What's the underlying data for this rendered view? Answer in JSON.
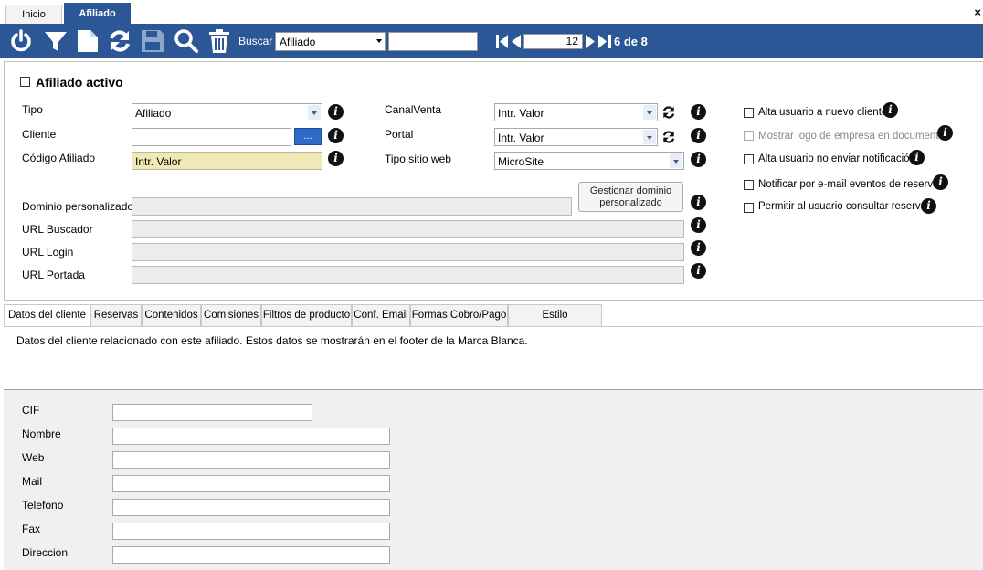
{
  "tabs": {
    "inicio": "Inicio",
    "afiliado": "Afiliado",
    "close": "×"
  },
  "toolbar": {
    "icons": [
      "power-icon",
      "filter-icon",
      "new-document-icon",
      "refresh-icon",
      "save-icon",
      "search-icon",
      "delete-icon"
    ],
    "buscar_label": "Buscar",
    "buscar_value": "Afiliado",
    "search_text": "",
    "page_value": "12",
    "count": "6 de 8"
  },
  "form": {
    "active_label": "Afiliado activo",
    "tipo_label": "Tipo",
    "tipo_value": "Afiliado",
    "cliente_label": "Cliente",
    "cliente_value": "",
    "ellipsis": "...",
    "codigo_label": "Código Afiliado",
    "codigo_value": "Intr. Valor",
    "canal_label": "CanalVenta",
    "canal_value": "Intr. Valor",
    "portal_label": "Portal",
    "portal_value": "Intr. Valor",
    "tipo_sitio_label": "Tipo sitio web",
    "tipo_sitio_value": "MicroSite",
    "gestionar_line1": "Gestionar dominio",
    "gestionar_line2": "personalizado",
    "dominio_label": "Dominio personalizado",
    "url_buscador_label": "URL Buscador",
    "url_login_label": "URL Login",
    "url_portada_label": "URL Portada"
  },
  "options": [
    {
      "label": "Alta usuario a nuevo cliente",
      "disabled": false
    },
    {
      "label": "Mostrar logo de empresa en documentos",
      "disabled": true
    },
    {
      "label": "Alta usuario no enviar notificación",
      "disabled": false
    },
    {
      "label": "Notificar por e-mail eventos de reservas",
      "disabled": false
    },
    {
      "label": "Permitir al usuario consultar reservas",
      "disabled": false
    }
  ],
  "subtabs": [
    "Datos del cliente",
    "Reservas",
    "Contenidos",
    "Comisiones",
    "Filtros de producto",
    "Conf. Email",
    "Formas Cobro/Pago",
    "Estilo personalizado"
  ],
  "cliente_data": {
    "description": "Datos del cliente relacionado con este afiliado. Estos datos se mostrarán en el footer de la Marca Blanca.",
    "fields": [
      "CIF",
      "Nombre",
      "Web",
      "Mail",
      "Telefono",
      "Fax",
      "Direccion"
    ]
  },
  "colors": {
    "accent": "#2b5797",
    "highlight": "#f1e9b5"
  }
}
